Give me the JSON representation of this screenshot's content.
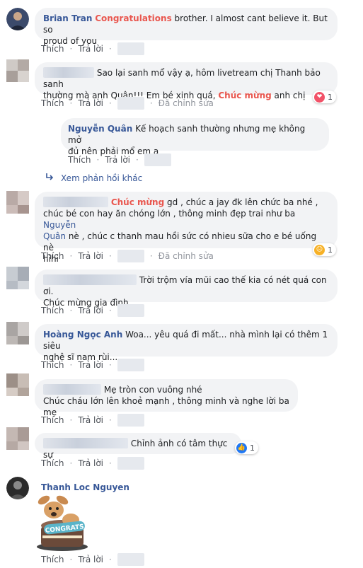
{
  "labels": {
    "like": "Thích",
    "reply": "Trả lời",
    "edited": "Đã chỉnh sửa",
    "more_replies": "Xem phản hồi khác"
  },
  "c1": {
    "name": "Brian Tran",
    "highlight": "Congratulations",
    "text1": " brother. I almost cant believe it. But so",
    "text2": "proud of you"
  },
  "c2": {
    "line1": "Sao lại sanh mổ vậy ạ, hôm livetream chị Thanh bảo sanh",
    "line2": "thường mà anh Quân!!! Em bé xinh quá, ",
    "highlight": "Chúc mừng",
    "line2b": " anh chị",
    "reaction": {
      "icon": "heart",
      "count": "1",
      "color": "#f25268"
    }
  },
  "c2r": {
    "name": "Nguyễn Quân",
    "text1": " Kế hoạch sanh thường nhưng mẹ không mở",
    "text2": "đủ nên phải mổ em ạ"
  },
  "c3": {
    "highlight": "Chúc mừng",
    "line1": " gd , chúc a jay đk lên chức ba nhé ,",
    "line2a": "chúc bé con hay ăn chóng lớn , thông minh đẹp trai như ba ",
    "mention1": "Nguyễn",
    "mention2": "Quân",
    "line3": " nè , chúc c thanh mau hồi sức có nhieu sữa cho e bé uống nè",
    "line4": "hihi",
    "reaction": {
      "icon": "sad",
      "count": "1",
      "color": "#f7b125"
    }
  },
  "c4": {
    "line1": "Trời trộm vía mũi cao thế kia có nét quá con ơi.",
    "line2": "Chúc mừng gia đình"
  },
  "c5": {
    "name": "Hoàng Ngọc Anh",
    "text1": " Woa... yêu quá đi mất... nhà mình lại có thêm 1 siêu",
    "text2": "nghệ sĩ nam rùi..."
  },
  "c6": {
    "line1": "Mẹ tròn con vuông nhé",
    "line2": "Chúc cháu lớn lên khoẻ mạnh , thông minh và nghe lời ba mẹ"
  },
  "c7": {
    "line1": "Chỉnh ảnh có tâm thực sự",
    "reaction": {
      "icon": "like",
      "count": "1",
      "color": "#2078f4"
    }
  },
  "c8": {
    "name": "Thanh Loc Nguyen",
    "sticker_text": "CONGRATS"
  }
}
